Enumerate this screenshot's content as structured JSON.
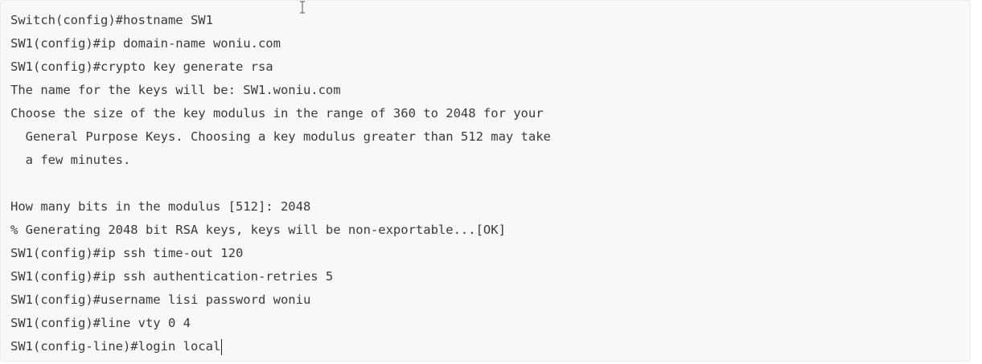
{
  "terminal": {
    "lines": [
      "Switch(config)#hostname SW1",
      "SW1(config)#ip domain-name woniu.com",
      "SW1(config)#crypto key generate rsa",
      "The name for the keys will be: SW1.woniu.com",
      "Choose the size of the key modulus in the range of 360 to 2048 for your",
      "  General Purpose Keys. Choosing a key modulus greater than 512 may take",
      "  a few minutes.",
      "",
      "How many bits in the modulus [512]: 2048",
      "% Generating 2048 bit RSA keys, keys will be non-exportable...[OK]",
      "SW1(config)#ip ssh time-out 120",
      "SW1(config)#ip ssh authentication-retries 5",
      "SW1(config)#username lisi password woniu",
      "SW1(config)#line vty 0 4",
      "SW1(config-line)#login local"
    ]
  }
}
